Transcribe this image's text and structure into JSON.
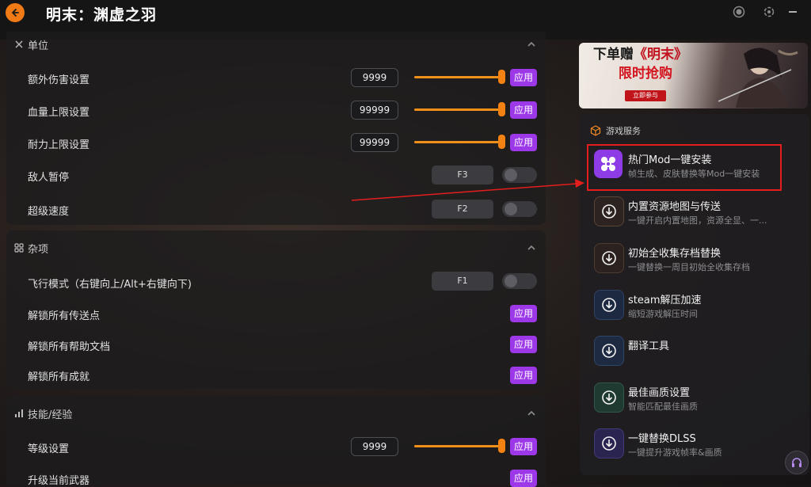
{
  "title": "明末：渊虚之羽",
  "sections": {
    "unit": {
      "title": "单位",
      "rows": {
        "damage": {
          "label": "额外伤害设置",
          "value": "9999",
          "apply": "应用"
        },
        "hp": {
          "label": "血量上限设置",
          "value": "99999",
          "apply": "应用"
        },
        "stamina": {
          "label": "耐力上限设置",
          "value": "99999",
          "apply": "应用"
        },
        "enemy_pause": {
          "label": "敌人暂停",
          "key": "F3"
        },
        "super_speed": {
          "label": "超级速度",
          "key": "F2"
        }
      }
    },
    "misc": {
      "title": "杂项",
      "rows": {
        "fly": {
          "label": "飞行模式（右键向上/Alt+右键向下)",
          "key": "F1"
        },
        "unlock_tp": {
          "label": "解锁所有传送点",
          "apply": "应用"
        },
        "unlock_docs": {
          "label": "解锁所有帮助文档",
          "apply": "应用"
        },
        "unlock_ach": {
          "label": "解锁所有成就",
          "apply": "应用"
        }
      }
    },
    "skills": {
      "title": "技能/经验",
      "rows": {
        "level": {
          "label": "等级设置",
          "value": "9999",
          "apply": "应用"
        },
        "partial": {
          "label": "升级当前武器",
          "apply": "应用"
        }
      }
    }
  },
  "banner": {
    "line1_a": "下单赠",
    "line1_b": "《明末》",
    "line2": "限时抢购",
    "button": "立即参与"
  },
  "services": {
    "title": "游戏服务",
    "items": [
      {
        "title": "热门Mod一键安装",
        "sub": "帧生成、皮肤替换等Mod一键安装"
      },
      {
        "title": "内置资源地图与传送",
        "sub": "一键开启内置地图，资源全显、一..."
      },
      {
        "title": "初始全收集存档替换",
        "sub": "一键替换一周目初始全收集存档"
      },
      {
        "title": "steam解压加速",
        "sub": "缩短游戏解压时间"
      },
      {
        "title": "翻译工具",
        "sub": ""
      },
      {
        "title": "最佳画质设置",
        "sub": "智能匹配最佳画质"
      },
      {
        "title": "一键替换DLSS",
        "sub": "一键提升游戏帧率&画质"
      }
    ]
  },
  "colors": {
    "accent": "#f07a16",
    "apply": "#9c38e8",
    "highlight": "#e41d1d"
  }
}
